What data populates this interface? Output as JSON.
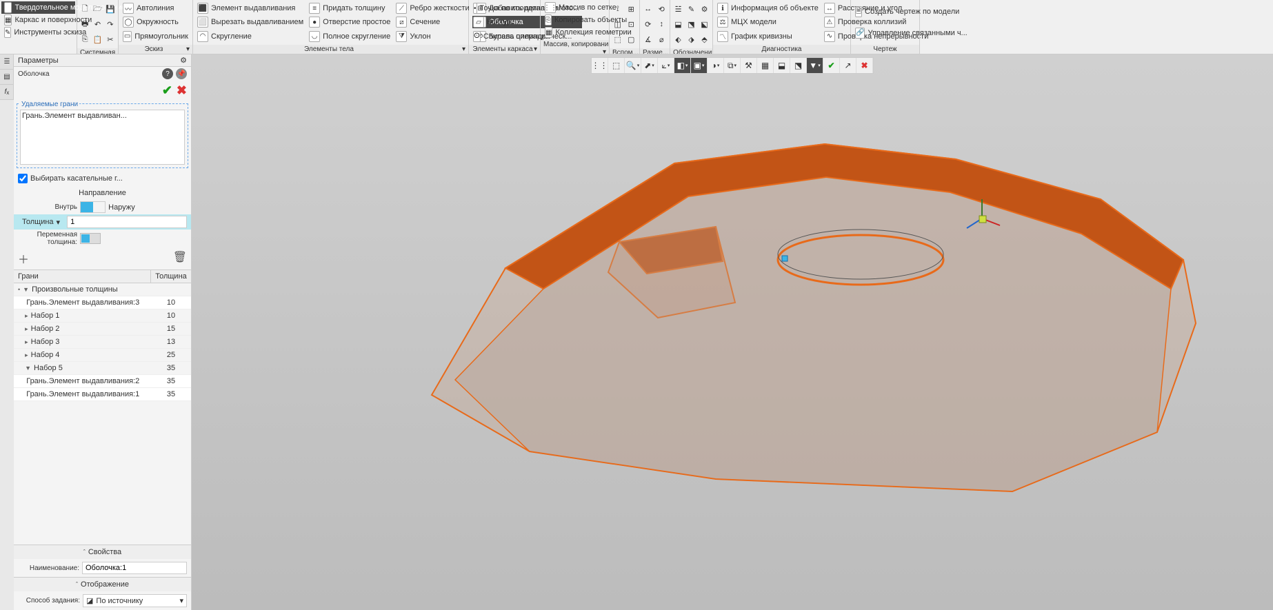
{
  "ribbon": {
    "tab_active": "Твердотельное моделирование",
    "groups": {
      "g1": {
        "title": "",
        "items": [
          "Каркас и поверхности",
          "Инструменты эскиза"
        ]
      },
      "sys": {
        "title": "Системная"
      },
      "sketch": {
        "title": "Эскиз",
        "items": [
          "Автолиния",
          "Окружность",
          "Прямоугольник"
        ]
      },
      "body": {
        "title": "Элементы тела",
        "items": [
          "Элемент выдавливания",
          "Вырезать выдавливанием",
          "Скругление",
          "Придать толщину",
          "Отверстие простое",
          "Полное скругление",
          "Ребро жесткости",
          "Сечение",
          "Уклон",
          "Добавить деталь-загото...",
          "Булева операция",
          "Оболочка"
        ]
      },
      "frame": {
        "title": "Элементы каркаса",
        "items": [
          "Точка по координатам",
          "Контур",
          "Спираль цилиндрическ..."
        ]
      },
      "array": {
        "title": "Массив, копирование",
        "items": [
          "Массив по сетке",
          "Копировать объекты",
          "Коллекция геометрии"
        ]
      },
      "aux": {
        "title": "Вспом..."
      },
      "dim": {
        "title": "Разме..."
      },
      "notations": {
        "title": "Обозначения"
      },
      "diag": {
        "title": "Диагностика",
        "items": [
          "Информация об объекте",
          "МЦХ модели",
          "График кривизны",
          "Расстояние и угол",
          "Проверка коллизий",
          "Проверка непрерывности"
        ]
      },
      "drawing": {
        "title": "Чертеж",
        "items": [
          "Создать чертеж по модели",
          "Управление связанными ч..."
        ]
      }
    }
  },
  "params": {
    "panel_title": "Параметры",
    "subtitle": "Оболочка",
    "removed_faces_label": "Удаляемые грани",
    "removed_faces_item": "Грань.Элемент выдавливан...",
    "select_tangent": "Выбирать касательные г...",
    "direction_label": "Направление",
    "dir_in": "Внутрь",
    "dir_out": "Наружу",
    "thickness_label": "Толщина",
    "thickness_value": "1",
    "var_thickness_label": "Переменная толщина:",
    "col_faces": "Грани",
    "col_thickness": "Толщина",
    "rows": [
      {
        "type": "header",
        "label": "Произвольные толщины",
        "expanded": true
      },
      {
        "type": "row",
        "label": "Грань.Элемент выдавливания:3",
        "val": "10"
      },
      {
        "type": "group",
        "label": "Набор 1",
        "val": "10"
      },
      {
        "type": "group",
        "label": "Набор 2",
        "val": "15"
      },
      {
        "type": "group",
        "label": "Набор 3",
        "val": "13"
      },
      {
        "type": "group",
        "label": "Набор 4",
        "val": "25"
      },
      {
        "type": "group",
        "label": "Набор 5",
        "val": "35",
        "expanded": true
      },
      {
        "type": "row",
        "label": "Грань.Элемент выдавливания:2",
        "val": "35"
      },
      {
        "type": "row",
        "label": "Грань.Элемент выдавливания:1",
        "val": "35"
      }
    ],
    "props_header": "Свойства",
    "name_label": "Наименование:",
    "name_value": "Оболочка:1",
    "display_header": "Отображение",
    "method_label": "Способ задания:",
    "method_value": "По источнику"
  }
}
